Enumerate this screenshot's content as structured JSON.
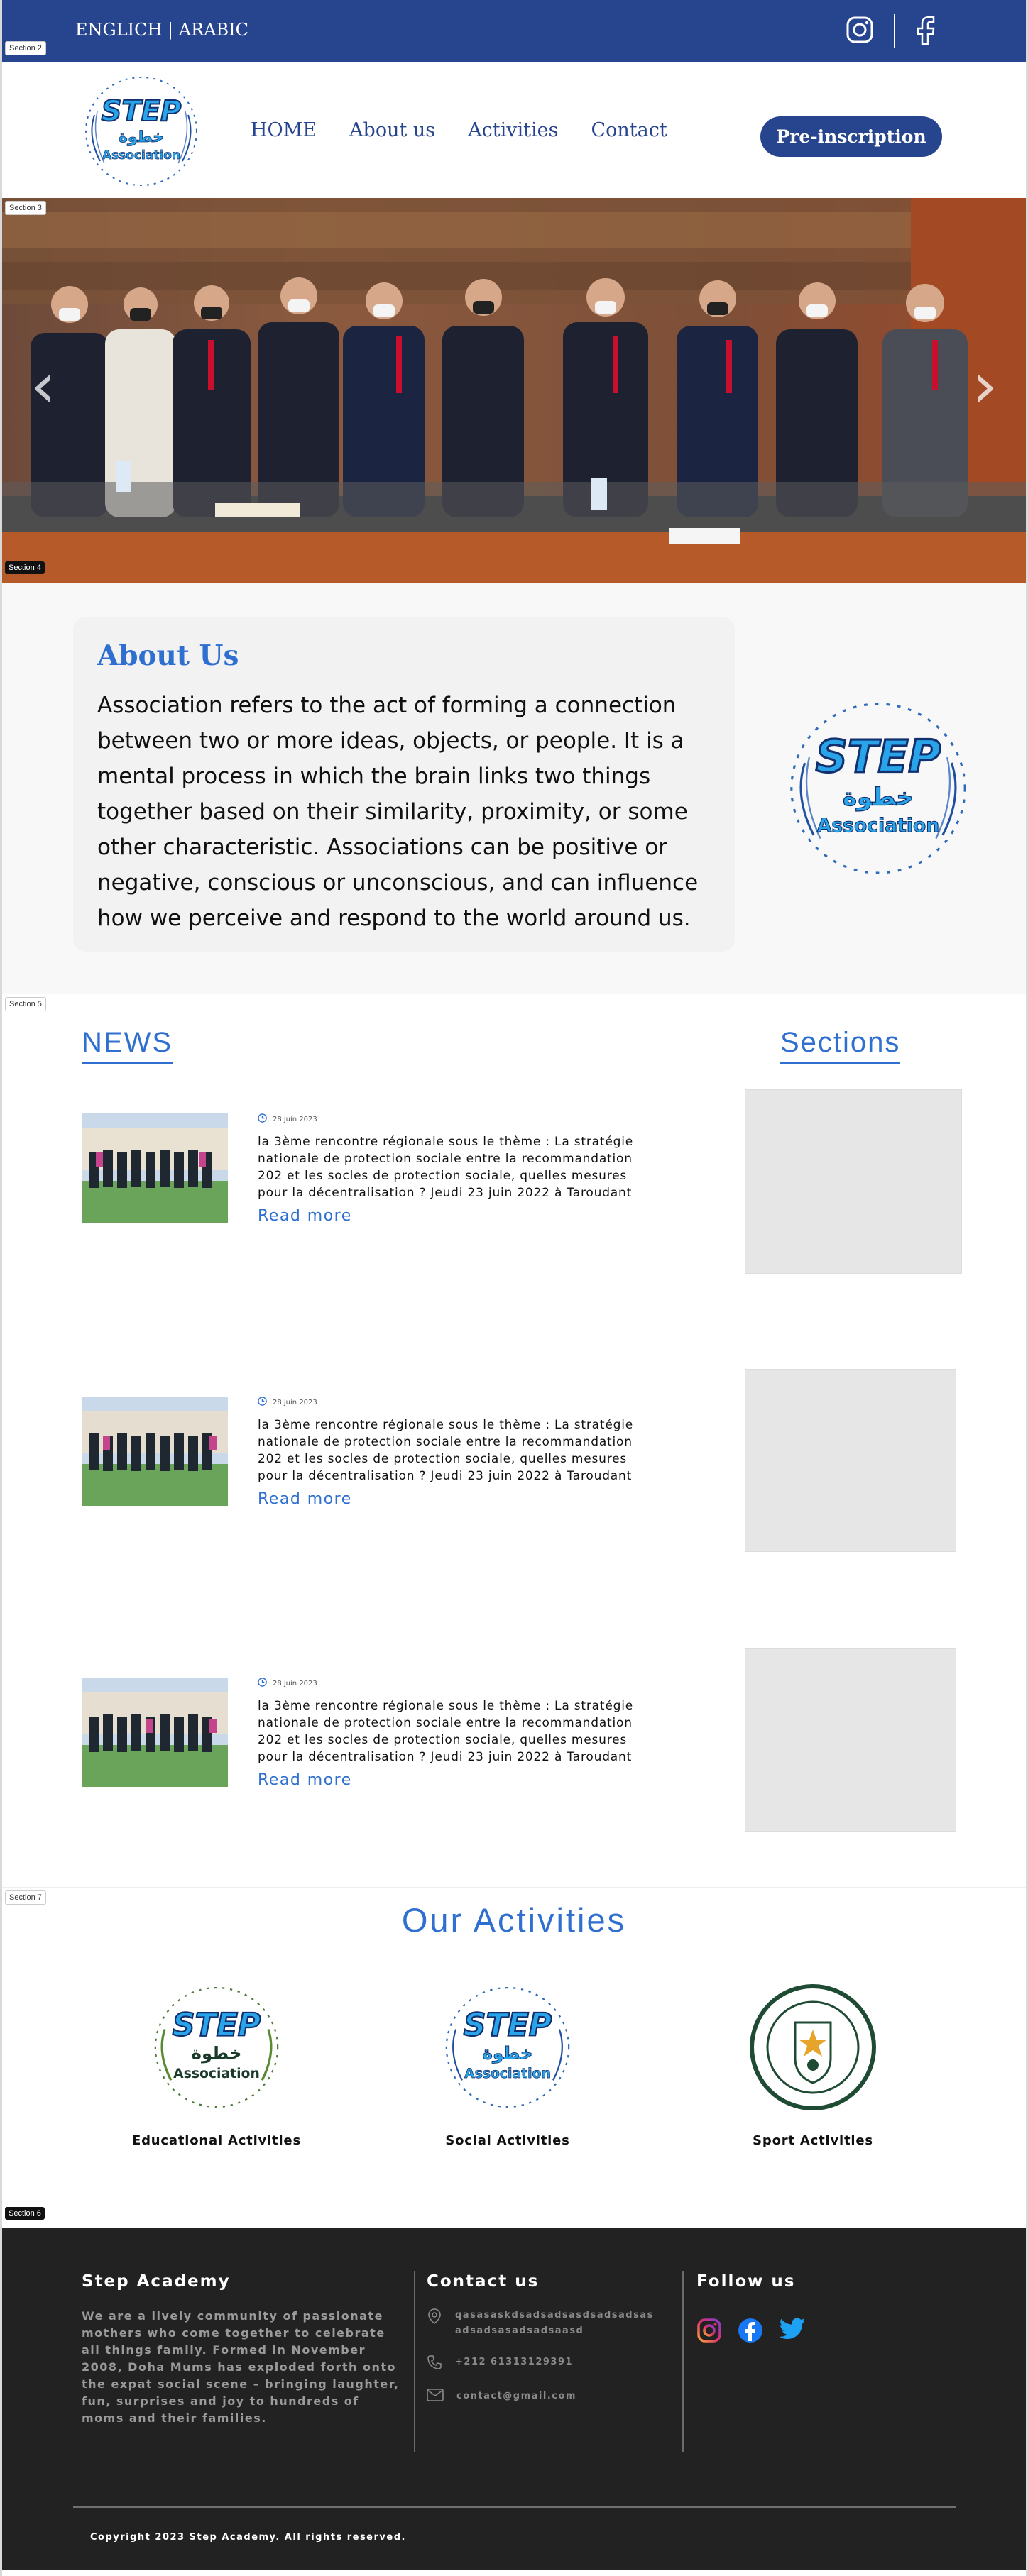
{
  "section_tags": {
    "s2": "Section 2",
    "s3": "Section 3",
    "s4": "Section 4",
    "s5": "Section 5",
    "s7": "Section 7",
    "s6": "Section 6"
  },
  "topbar": {
    "language": "ENGLICH | ARABIC",
    "icons": [
      "instagram-icon",
      "facebook-icon"
    ]
  },
  "header": {
    "logo_text": "STEP",
    "logo_arabic": "خطوة",
    "logo_subtext": "Association",
    "nav": [
      "HOME",
      "About us",
      "Activities",
      "Contact"
    ],
    "cta": "Pre-inscription"
  },
  "hero": {
    "prev_icon": "chevron-left-icon",
    "next_icon": "chevron-right-icon"
  },
  "about": {
    "title": "About Us",
    "text": "Association refers to the act of forming a connection between two or more ideas, objects, or people. It is a mental process in which the brain links two things together based on their similarity, proximity, or some other characteristic. Associations can be positive or negative, conscious or unconscious, and can influence how we perceive and respond to the world around us."
  },
  "news": {
    "heading": "NEWS",
    "sections_heading": "Sections",
    "items": [
      {
        "date": "28 juin 2023",
        "text": "la 3ème rencontre régionale sous le thème : La stratégie nationale de protection sociale entre la recommandation 202 et les socles de protection sociale, quelles mesures pour la décentralisation ? Jeudi 23 juin 2022 à Taroudant",
        "link": "Read more"
      },
      {
        "date": "28 juin 2023",
        "text": "la 3ème rencontre régionale sous le thème : La stratégie nationale de protection sociale entre la recommandation 202 et les socles de protection sociale, quelles mesures pour la décentralisation ? Jeudi 23 juin 2022 à Taroudant",
        "link": "Read more"
      },
      {
        "date": "28 juin 2023",
        "text": "la 3ème rencontre régionale sous le thème : La stratégie nationale de protection sociale entre la recommandation 202 et les socles de protection sociale, quelles mesures pour la décentralisation ? Jeudi 23 juin 2022 à Taroudant",
        "link": "Read more"
      }
    ]
  },
  "activities": {
    "title": "Our Activities",
    "items": [
      {
        "label": "Educational Activities"
      },
      {
        "label": "Social Activities"
      },
      {
        "label": "Sport Activities"
      }
    ]
  },
  "footer": {
    "brand_title": "Step Academy",
    "brand_text": "We are a lively community of passionate mothers who come together to celebrate all things family. Formed in November 2008, Doha Mums has exploded forth onto the expat social scene – bringing laughter, fun, surprises and joy to hundreds of moms and their families.",
    "contact_title": "Contact us",
    "address": "qasasaskdsadsadsasdsadsadsasadsadsasadsadsaasd",
    "phone": "+212 61313129391",
    "email": "contact@gmail.com",
    "follow_title": "Follow us",
    "social_icons": [
      "instagram-icon",
      "facebook-icon",
      "twitter-icon"
    ],
    "copyright": "Copyright 2023 Step Academy. All rights reserved."
  },
  "colors": {
    "brand_blue": "#27458e",
    "accent_blue": "#2f6fd0",
    "footer_bg": "#222222"
  }
}
